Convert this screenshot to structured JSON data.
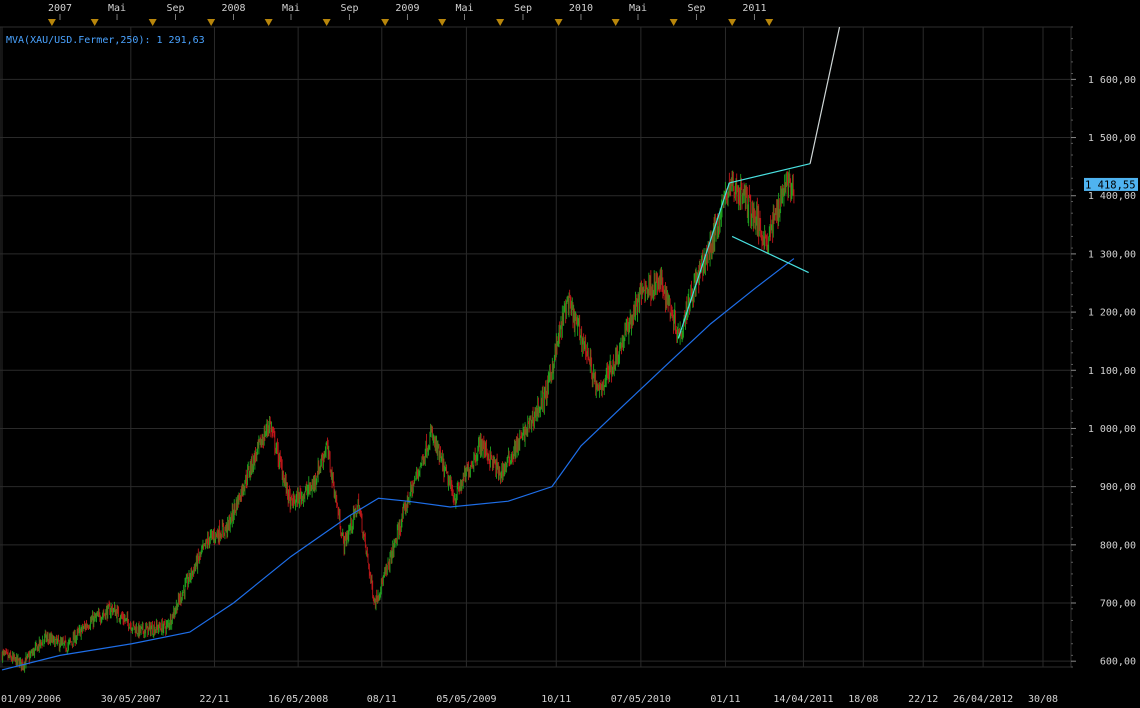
{
  "chart_data": {
    "type": "line",
    "style": "candlestick",
    "legend": {
      "text": "MVA(XAU/USD.Fermer,250): 1 291,63"
    },
    "last_price": {
      "label": "1 418,55",
      "value": 1418.55,
      "color": "#4fb3f0"
    },
    "ylim": [
      590,
      690
    ],
    "ylim_data": [
      590,
      1690
    ],
    "y_ticks": [
      {
        "value": 600,
        "label": "600,00"
      },
      {
        "value": 700,
        "label": "700,00"
      },
      {
        "value": 800,
        "label": "800,00"
      },
      {
        "value": 900,
        "label": "900,00"
      },
      {
        "value": 1000,
        "label": "1 000,00"
      },
      {
        "value": 1100,
        "label": "1 100,00"
      },
      {
        "value": 1200,
        "label": "1 200,00"
      },
      {
        "value": 1300,
        "label": "1 300,00"
      },
      {
        "value": 1400,
        "label": "1 400,00"
      },
      {
        "value": 1500,
        "label": "1 500,00"
      },
      {
        "value": 1600,
        "label": "1 600,00"
      }
    ],
    "x_ticks_bottom": [
      {
        "date": "2006-09-01",
        "label": "01/09/2006"
      },
      {
        "date": "2007-05-30",
        "label": "30/05/2007"
      },
      {
        "date": "2007-11-22",
        "label": "22/11"
      },
      {
        "date": "2008-05-16",
        "label": "16/05/2008"
      },
      {
        "date": "2008-11-08",
        "label": "08/11"
      },
      {
        "date": "2009-05-05",
        "label": "05/05/2009"
      },
      {
        "date": "2009-11-10",
        "label": "10/11"
      },
      {
        "date": "2010-05-07",
        "label": "07/05/2010"
      },
      {
        "date": "2010-11-01",
        "label": "01/11"
      },
      {
        "date": "2011-04-14",
        "label": "14/04/2011"
      },
      {
        "date": "2011-08-18",
        "label": "18/08"
      },
      {
        "date": "2011-12-22",
        "label": "22/12"
      },
      {
        "date": "2012-04-26",
        "label": "26/04/2012"
      },
      {
        "date": "2012-08-30",
        "label": "30/08"
      }
    ],
    "x_ticks_top": [
      {
        "date": "2007-01-01",
        "label": "2007"
      },
      {
        "date": "2007-05-01",
        "label": "Mai"
      },
      {
        "date": "2007-09-01",
        "label": "Sep"
      },
      {
        "date": "2008-01-01",
        "label": "2008"
      },
      {
        "date": "2008-05-01",
        "label": "Mai"
      },
      {
        "date": "2008-09-01",
        "label": "Sep"
      },
      {
        "date": "2009-01-01",
        "label": "2009"
      },
      {
        "date": "2009-05-01",
        "label": "Mai"
      },
      {
        "date": "2009-09-01",
        "label": "Sep"
      },
      {
        "date": "2010-01-01",
        "label": "2010"
      },
      {
        "date": "2010-05-01",
        "label": "Mai"
      },
      {
        "date": "2010-09-01",
        "label": "Sep"
      },
      {
        "date": "2011-01-01",
        "label": "2011"
      }
    ],
    "event_markers": [
      "2006-12-15",
      "2007-03-15",
      "2007-07-15",
      "2007-11-15",
      "2008-03-15",
      "2008-07-15",
      "2008-11-15",
      "2009-03-15",
      "2009-07-15",
      "2009-11-15",
      "2010-03-15",
      "2010-07-15",
      "2010-11-15",
      "2011-02-01"
    ],
    "marker_color": "#b8860b",
    "price_anchors": [
      {
        "date": "2006-09-01",
        "close": 612
      },
      {
        "date": "2006-10-15",
        "close": 595
      },
      {
        "date": "2006-12-01",
        "close": 640
      },
      {
        "date": "2007-01-15",
        "close": 625
      },
      {
        "date": "2007-03-01",
        "close": 665
      },
      {
        "date": "2007-04-20",
        "close": 690
      },
      {
        "date": "2007-06-15",
        "close": 652
      },
      {
        "date": "2007-08-15",
        "close": 660
      },
      {
        "date": "2007-10-01",
        "close": 745
      },
      {
        "date": "2007-11-10",
        "close": 810
      },
      {
        "date": "2007-12-20",
        "close": 830
      },
      {
        "date": "2008-01-30",
        "close": 920
      },
      {
        "date": "2008-03-17",
        "close": 1010
      },
      {
        "date": "2008-04-30",
        "close": 870
      },
      {
        "date": "2008-06-15",
        "close": 900
      },
      {
        "date": "2008-07-15",
        "close": 970
      },
      {
        "date": "2008-08-20",
        "close": 800
      },
      {
        "date": "2008-09-20",
        "close": 870
      },
      {
        "date": "2008-10-24",
        "close": 700
      },
      {
        "date": "2008-11-20",
        "close": 760
      },
      {
        "date": "2008-12-30",
        "close": 870
      },
      {
        "date": "2009-02-20",
        "close": 990
      },
      {
        "date": "2009-04-10",
        "close": 880
      },
      {
        "date": "2009-06-05",
        "close": 975
      },
      {
        "date": "2009-07-15",
        "close": 920
      },
      {
        "date": "2009-09-10",
        "close": 1000
      },
      {
        "date": "2009-10-20",
        "close": 1060
      },
      {
        "date": "2009-12-03",
        "close": 1220
      },
      {
        "date": "2010-01-15",
        "close": 1130
      },
      {
        "date": "2010-02-05",
        "close": 1060
      },
      {
        "date": "2010-03-15",
        "close": 1120
      },
      {
        "date": "2010-05-12",
        "close": 1240
      },
      {
        "date": "2010-06-20",
        "close": 1250
      },
      {
        "date": "2010-07-28",
        "close": 1160
      },
      {
        "date": "2010-08-15",
        "close": 1220
      },
      {
        "date": "2010-09-30",
        "close": 1310
      },
      {
        "date": "2010-11-09",
        "close": 1420
      },
      {
        "date": "2010-12-10",
        "close": 1400
      },
      {
        "date": "2011-01-28",
        "close": 1320
      },
      {
        "date": "2011-03-10",
        "close": 1430
      },
      {
        "date": "2011-03-25",
        "close": 1400
      }
    ],
    "moving_average": {
      "name": "MVA(XAU/USD.Fermer,250)",
      "color": "#1e6ee8",
      "points": [
        {
          "date": "2006-09-01",
          "value": 585
        },
        {
          "date": "2007-01-01",
          "value": 610
        },
        {
          "date": "2007-06-01",
          "value": 630
        },
        {
          "date": "2007-10-01",
          "value": 650
        },
        {
          "date": "2008-01-01",
          "value": 700
        },
        {
          "date": "2008-05-01",
          "value": 780
        },
        {
          "date": "2008-09-01",
          "value": 850
        },
        {
          "date": "2008-11-01",
          "value": 880
        },
        {
          "date": "2009-01-01",
          "value": 875
        },
        {
          "date": "2009-04-01",
          "value": 865
        },
        {
          "date": "2009-08-01",
          "value": 875
        },
        {
          "date": "2009-11-01",
          "value": 900
        },
        {
          "date": "2010-01-01",
          "value": 970
        },
        {
          "date": "2010-04-01",
          "value": 1040
        },
        {
          "date": "2010-07-01",
          "value": 1110
        },
        {
          "date": "2010-10-01",
          "value": 1180
        },
        {
          "date": "2011-01-01",
          "value": 1240
        },
        {
          "date": "2011-03-25",
          "value": 1292
        }
      ]
    },
    "trendlines": [
      {
        "color": "#49e0e0",
        "points": [
          {
            "date": "2010-07-25",
            "value": 1155
          },
          {
            "date": "2010-11-09",
            "value": 1422
          }
        ]
      },
      {
        "color": "#49e0e0",
        "points": [
          {
            "date": "2010-11-09",
            "value": 1422
          },
          {
            "date": "2011-04-28",
            "value": 1455
          }
        ]
      },
      {
        "color": "#49e0e0",
        "points": [
          {
            "date": "2010-11-15",
            "value": 1330
          },
          {
            "date": "2011-04-25",
            "value": 1268
          }
        ]
      },
      {
        "color": "#cfd6d6",
        "points": [
          {
            "date": "2011-04-28",
            "value": 1455
          },
          {
            "date": "2011-06-29",
            "value": 1690
          }
        ]
      }
    ]
  }
}
